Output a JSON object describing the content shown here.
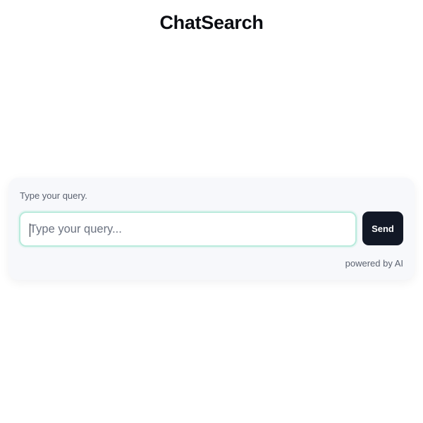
{
  "header": {
    "title": "ChatSearch"
  },
  "query_card": {
    "label": "Type your query.",
    "input": {
      "value": "",
      "placeholder": "Type your query..."
    },
    "send_label": "Send",
    "footer_text": "powered by AI"
  },
  "colors": {
    "title_text": "#0b0d12",
    "card_background": "#f7f8fb",
    "input_focus_border": "#b9eadc",
    "send_button_background": "#121826",
    "send_button_text": "#ffffff",
    "muted_text": "#5b6270"
  }
}
